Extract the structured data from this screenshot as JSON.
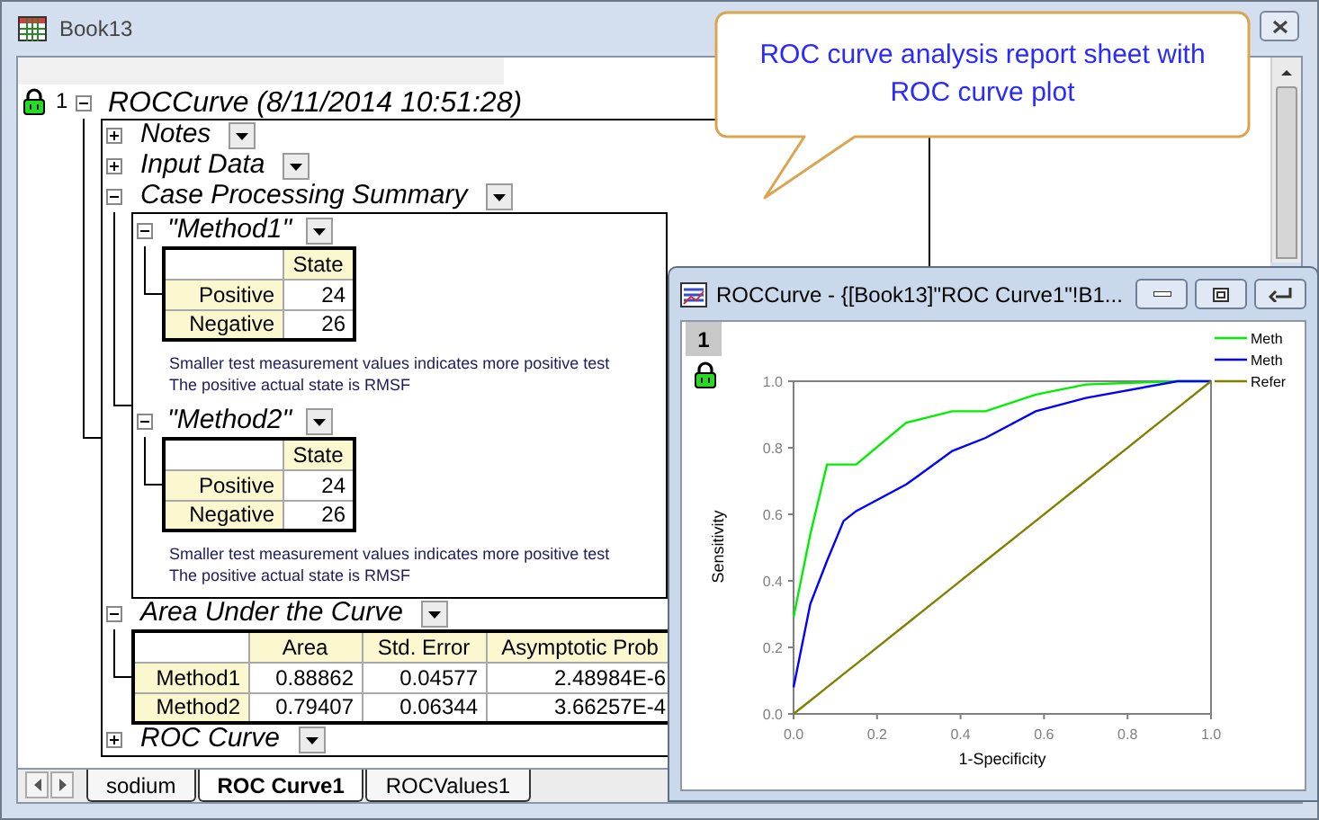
{
  "window": {
    "title": "Book13"
  },
  "callout": {
    "text": "ROC curve analysis report sheet with ROC curve plot"
  },
  "report": {
    "row_number": "1",
    "title": "ROCCurve (8/11/2014 10:51:28)",
    "expanded": true,
    "sections": [
      {
        "title": "Notes",
        "expanded": false
      },
      {
        "title": "Input Data",
        "expanded": false
      },
      {
        "title": "Case Processing Summary",
        "expanded": true,
        "groups": [
          {
            "title": "\"Method1\"",
            "expanded": true,
            "table": {
              "columns": [
                "State"
              ],
              "rows": [
                {
                  "label": "Positive",
                  "values": [
                    "24"
                  ]
                },
                {
                  "label": "Negative",
                  "values": [
                    "26"
                  ]
                }
              ]
            },
            "notes": [
              "Smaller test measurement values indicates more positive test",
              "The positive actual state is RMSF"
            ]
          },
          {
            "title": "\"Method2\"",
            "expanded": true,
            "table": {
              "columns": [
                "State"
              ],
              "rows": [
                {
                  "label": "Positive",
                  "values": [
                    "24"
                  ]
                },
                {
                  "label": "Negative",
                  "values": [
                    "26"
                  ]
                }
              ]
            },
            "notes": [
              "Smaller test measurement values indicates more positive test",
              "The positive actual state is RMSF"
            ]
          }
        ]
      },
      {
        "title": "Area Under the Curve",
        "expanded": true,
        "table": {
          "columns": [
            "Area",
            "Std. Error",
            "Asymptotic Prob"
          ],
          "rows": [
            {
              "label": "Method1",
              "values": [
                "0.88862",
                "0.04577",
                "2.48984E-6"
              ]
            },
            {
              "label": "Method2",
              "values": [
                "0.79407",
                "0.06344",
                "3.66257E-4"
              ]
            }
          ]
        }
      },
      {
        "title": "ROC Curve",
        "expanded": false
      }
    ]
  },
  "sheet_tabs": [
    {
      "label": "sodium",
      "selected": false
    },
    {
      "label": "ROC Curve1",
      "selected": true
    },
    {
      "label": "ROCValues1",
      "selected": false
    }
  ],
  "plot_window": {
    "title": "ROCCurve - {[Book13]\"ROC Curve1\"!B1...",
    "layer": "1",
    "chart_data": {
      "type": "line",
      "xlabel": "1-Specificity",
      "ylabel": "Sensitivity",
      "x": [
        0,
        0.04,
        0.08,
        0.12,
        0.15,
        0.27,
        0.38,
        0.46,
        0.58,
        0.7,
        0.92,
        1
      ],
      "series": [
        {
          "name": "Meth",
          "color": "#00ee00",
          "values": [
            0.29,
            0.54,
            0.75,
            0.75,
            0.75,
            0.875,
            0.91,
            0.91,
            0.96,
            0.99,
            1,
            1
          ]
        },
        {
          "name": "Meth",
          "color": "#0000ff",
          "values": [
            0.08,
            0.33,
            0.46,
            0.58,
            0.61,
            0.69,
            0.79,
            0.83,
            0.91,
            0.95,
            1,
            1
          ]
        },
        {
          "name": "Refer",
          "color": "#808000",
          "values": [
            0,
            0.04,
            0.08,
            0.12,
            0.15,
            0.27,
            0.38,
            0.46,
            0.58,
            0.7,
            0.92,
            1
          ]
        }
      ],
      "xlim": [
        0,
        1
      ],
      "ylim": [
        0,
        1
      ],
      "legend": "upper right",
      "xticks": [
        {
          "value": 0,
          "label": "0.0"
        },
        {
          "value": 0.2,
          "label": "0.2"
        },
        {
          "value": 0.4,
          "label": "0.4"
        },
        {
          "value": 0.6,
          "label": "0.6"
        },
        {
          "value": 0.8,
          "label": "0.8"
        },
        {
          "value": 1,
          "label": "1.0"
        }
      ],
      "yticks": [
        {
          "value": 0,
          "label": "0.0"
        },
        {
          "value": 0.2,
          "label": "0.2"
        },
        {
          "value": 0.4,
          "label": "0.4"
        },
        {
          "value": 0.6,
          "label": "0.6"
        },
        {
          "value": 0.8,
          "label": "0.8"
        },
        {
          "value": 1,
          "label": "1.0"
        }
      ]
    }
  }
}
